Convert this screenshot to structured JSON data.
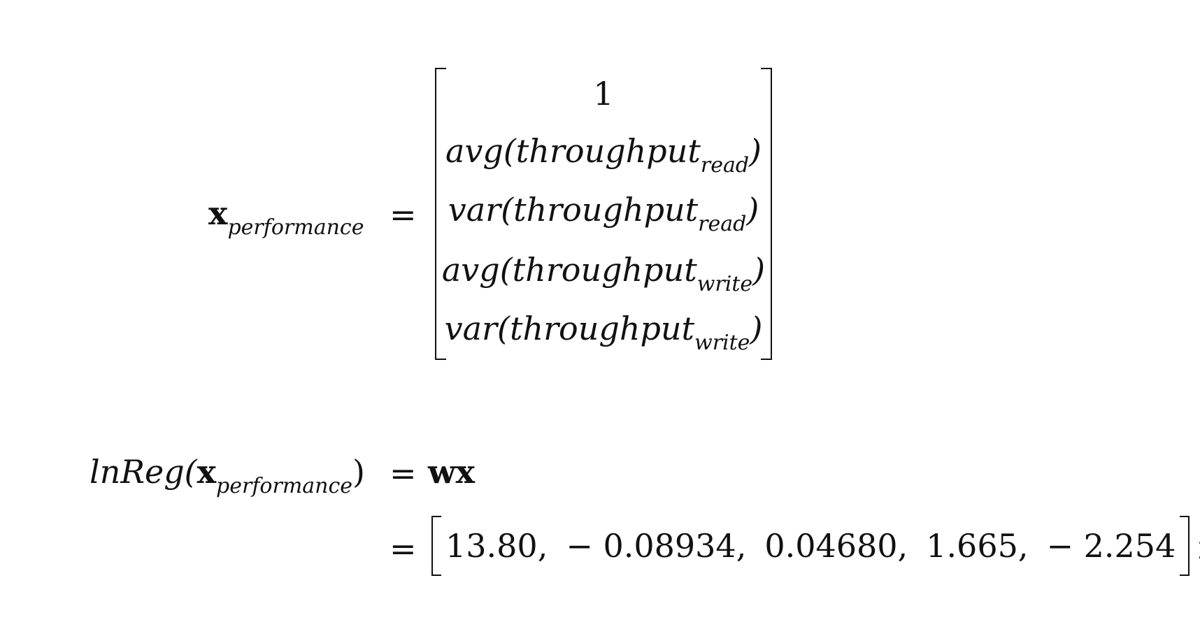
{
  "equation1": {
    "lhs_symbol": "x",
    "lhs_subscript": "performance",
    "equals": "=",
    "vector": [
      {
        "fn": "1",
        "var": "",
        "sub": ""
      },
      {
        "fn": "avg(",
        "var": "throughput",
        "sub": "read",
        "close": ")"
      },
      {
        "fn": "var(",
        "var": "throughput",
        "sub": "read",
        "close": ")"
      },
      {
        "fn": "avg(",
        "var": "throughput",
        "sub": "write",
        "close": ")"
      },
      {
        "fn": "var(",
        "var": "throughput",
        "sub": "write",
        "close": ")"
      }
    ]
  },
  "equation2": {
    "lhs_fn": "lnReg(",
    "lhs_symbol": "x",
    "lhs_subscript": "performance",
    "lhs_close": ")",
    "equals": "=",
    "rhs": "wx",
    "weights": [
      "13.80,",
      "− 0.08934,",
      "0.04680,",
      "1.665,",
      "− 2.254"
    ],
    "tail": "x"
  }
}
